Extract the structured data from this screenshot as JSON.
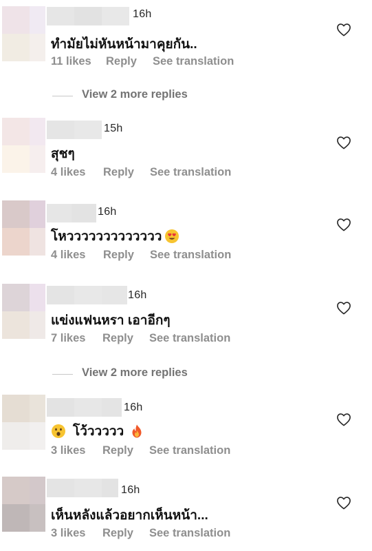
{
  "comments": [
    {
      "time": "16h",
      "text": "ทำมัยไม่หันหน้ามาคุยกัน..",
      "likes": "11 likes",
      "reply": "Reply",
      "translate": "See translation",
      "avatar_colors": [
        "#efe3e8",
        "#f0eaf3",
        "#f1ece3",
        "#f4efec"
      ]
    },
    {
      "time": "15h",
      "text": "สุชๆ",
      "likes": "4 likes",
      "reply": "Reply",
      "translate": "See translation",
      "avatar_colors": [
        "#f3e6e6",
        "#f2e8f0",
        "#fbf3e9",
        "#f6eeee"
      ]
    },
    {
      "time": "16h",
      "text": "โหววววววววววววว",
      "emoji_after": "heart-eyes-emoji",
      "likes": "4 likes",
      "reply": "Reply",
      "translate": "See translation",
      "avatar_colors": [
        "#d9c9c9",
        "#e0d0dc",
        "#ecd5cc",
        "#efe3e1"
      ]
    },
    {
      "time": "16h",
      "text": "แข่งแฟนหรา เอาอีกๆ",
      "likes": "7 likes",
      "reply": "Reply",
      "translate": "See translation",
      "avatar_colors": [
        "#ddd4d8",
        "#ece0ec",
        "#ece4dc",
        "#efe9e7"
      ]
    },
    {
      "time": "16h",
      "text": "โว้ววววว",
      "emoji_before": "surprised-face-emoji",
      "emoji_after": "fire-emoji",
      "likes": "3 likes",
      "reply": "Reply",
      "translate": "See translation",
      "avatar_colors": [
        "#e5ddd3",
        "#e9e3da",
        "#efedeb",
        "#f2f0ef"
      ]
    },
    {
      "time": "16h",
      "text": "เห็นหลังแล้วอยากเห็นหน้า...",
      "likes": "3 likes",
      "reply": "Reply",
      "translate": "See translation",
      "avatar_colors": [
        "#d6cac8",
        "#d3c8ca",
        "#bfb7b7",
        "#c8c0c0"
      ]
    }
  ],
  "view_more": [
    {
      "label": "View 2 more replies"
    },
    {
      "label": "View 2 more replies"
    }
  ],
  "colors": {
    "secondary_text": "#8e8e8e",
    "primary_text": "#111111",
    "redacted_username": "#e4e4e4"
  }
}
